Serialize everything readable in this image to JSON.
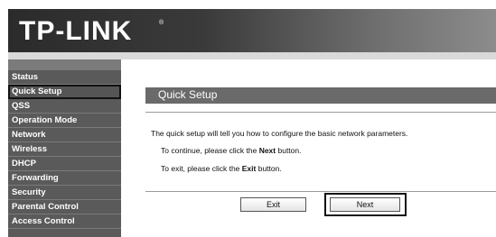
{
  "brand": {
    "logo_text": "TP-LINK",
    "registered_mark": "®"
  },
  "sidebar": {
    "items": [
      {
        "label": "Status"
      },
      {
        "label": "Quick Setup",
        "active": true
      },
      {
        "label": "QSS"
      },
      {
        "label": "Operation Mode"
      },
      {
        "label": "Network"
      },
      {
        "label": "Wireless"
      },
      {
        "label": "DHCP"
      },
      {
        "label": "Forwarding"
      },
      {
        "label": "Security"
      },
      {
        "label": "Parental Control"
      },
      {
        "label": "Access Control"
      }
    ]
  },
  "main": {
    "title": "Quick Setup",
    "intro": "The quick setup will tell you how to configure the basic network parameters.",
    "continue_prefix": "To continue, please click the ",
    "continue_button_word": "Next",
    "continue_suffix": " button.",
    "exit_prefix": "To exit, please click the ",
    "exit_button_word": "Exit",
    "exit_suffix": "  button."
  },
  "buttons": {
    "exit_label": "Exit",
    "next_label": "Next"
  },
  "colors": {
    "header_dark": "#2b2b2b",
    "sidebar_bg": "#5a5a5a",
    "title_bar": "#6a6a6a"
  }
}
